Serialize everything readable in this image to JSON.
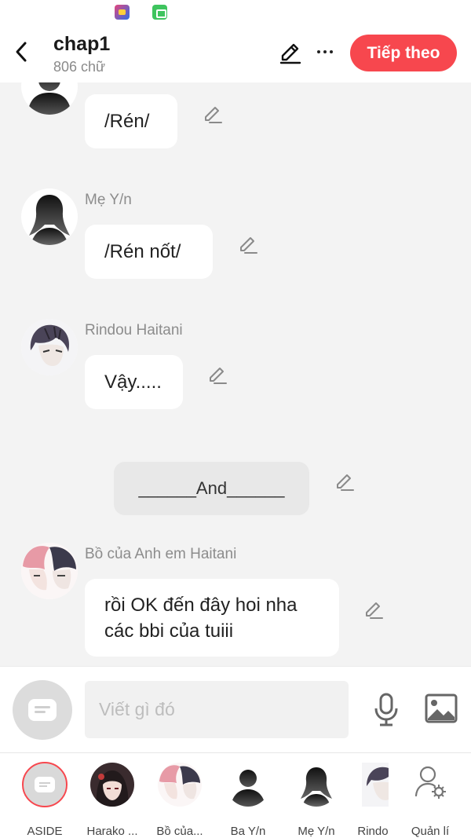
{
  "header": {
    "title": "chap1",
    "word_count": "806 chữ",
    "next_label": "Tiếp theo"
  },
  "messages": [
    {
      "name": "",
      "text": "/Rén/"
    },
    {
      "name": "Mẹ Y/n",
      "text": "/Rén nốt/"
    },
    {
      "name": "Rindou Haitani",
      "text": "Vậy....."
    },
    {
      "narration": "______And______"
    },
    {
      "name": "Bồ của Anh em Haitani",
      "line1": "rồi OK đến đây hoi nha",
      "line2": "các bbi của tuiii"
    }
  ],
  "input": {
    "placeholder": "Viết gì đó"
  },
  "characters": [
    {
      "label": "ASIDE"
    },
    {
      "label": "Harako ..."
    },
    {
      "label": "Bồ của..."
    },
    {
      "label": "Ba Y/n"
    },
    {
      "label": "Mẹ Y/n"
    },
    {
      "label": "Rindo"
    },
    {
      "label": "Quản lí"
    }
  ],
  "colors": {
    "accent": "#f7474e",
    "background": "#f3f3f3",
    "bubble": "#ffffff",
    "narration": "#e8e8e8"
  }
}
